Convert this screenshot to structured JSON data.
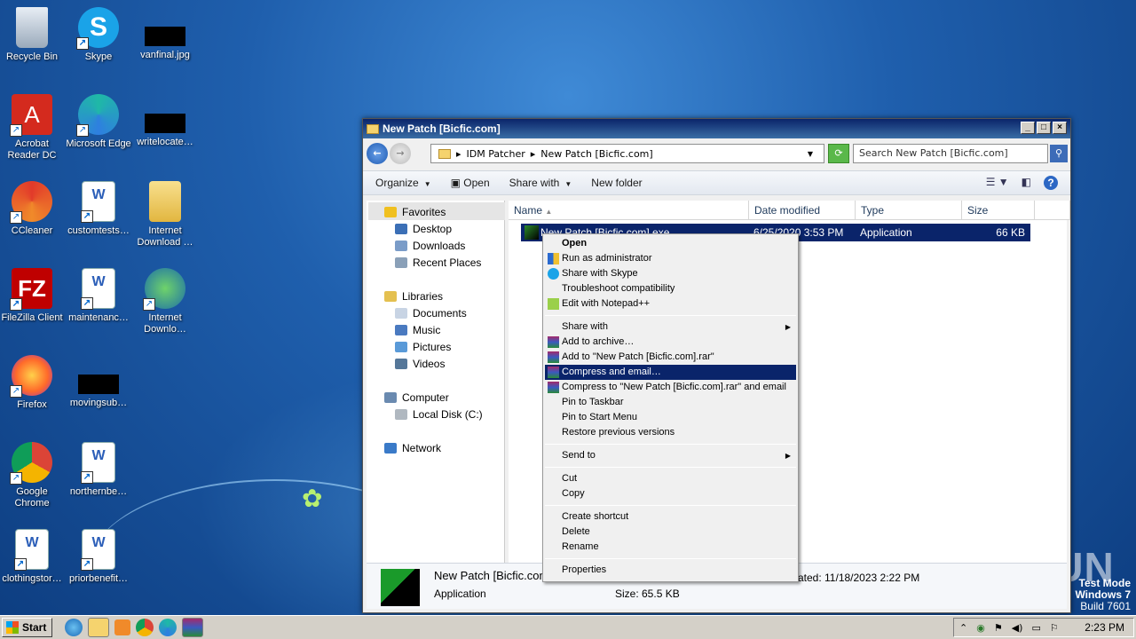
{
  "desktop": {
    "icons": [
      {
        "label": "Recycle Bin",
        "icon": "recycle-bin-icon"
      },
      {
        "label": "Skype",
        "icon": "skype-icon"
      },
      {
        "label": "vanfinal.jpg",
        "icon": "image-thumbnail-icon"
      },
      {
        "label": "Acrobat Reader DC",
        "icon": "acrobat-icon"
      },
      {
        "label": "Microsoft Edge",
        "icon": "edge-icon"
      },
      {
        "label": "writelocate…",
        "icon": "image-thumbnail-icon"
      },
      {
        "label": "CCleaner",
        "icon": "ccleaner-icon"
      },
      {
        "label": "customtests…",
        "icon": "word-doc-icon"
      },
      {
        "label": "Internet Download …",
        "icon": "folder-icon"
      },
      {
        "label": "FileZilla Client",
        "icon": "filezilla-icon"
      },
      {
        "label": "maintenanc…",
        "icon": "word-doc-icon"
      },
      {
        "label": "Internet Downlo…",
        "icon": "idm-icon"
      },
      {
        "label": "Firefox",
        "icon": "firefox-icon"
      },
      {
        "label": "movingsub…",
        "icon": "image-thumbnail-icon"
      },
      {
        "label": "Google Chrome",
        "icon": "chrome-icon"
      },
      {
        "label": "northernbe…",
        "icon": "word-doc-icon"
      },
      {
        "label": "clothingstor…",
        "icon": "word-doc-icon"
      },
      {
        "label": "priorbenefit…",
        "icon": "word-doc-icon"
      }
    ]
  },
  "window": {
    "title": "New Patch [Bicfic.com]",
    "breadcrumb": [
      "IDM Patcher",
      "New Patch [Bicfic.com]"
    ],
    "search_placeholder": "Search New Patch [Bicfic.com]",
    "toolbar": {
      "organize": "Organize",
      "open": "Open",
      "share_with": "Share with",
      "new_folder": "New folder"
    },
    "nav": {
      "favorites": "Favorites",
      "desktop": "Desktop",
      "downloads": "Downloads",
      "recent": "Recent Places",
      "libraries": "Libraries",
      "documents": "Documents",
      "music": "Music",
      "pictures": "Pictures",
      "videos": "Videos",
      "computer": "Computer",
      "local_disk": "Local Disk (C:)",
      "network": "Network"
    },
    "columns": {
      "name": "Name",
      "date": "Date modified",
      "type": "Type",
      "size": "Size"
    },
    "file": {
      "name": "New Patch [Bicfic.com].exe",
      "date": "6/25/2020 3:53 PM",
      "type": "Application",
      "size": "66 KB"
    },
    "details": {
      "name": "New Patch [Bicfic.com]",
      "type": "Application",
      "size": "Size: 65.5 KB",
      "date": "ated: 11/18/2023 2:22 PM"
    }
  },
  "context_menu": {
    "open": "Open",
    "run_admin": "Run as administrator",
    "share_skype": "Share with Skype",
    "troubleshoot": "Troubleshoot compatibility",
    "notepad": "Edit with Notepad++",
    "share_with": "Share with",
    "add_archive": "Add to archive…",
    "add_rar": "Add to \"New Patch [Bicfic.com].rar\"",
    "compress_email": "Compress and email…",
    "compress_rar_email": "Compress to \"New Patch [Bicfic.com].rar\" and email",
    "pin_taskbar": "Pin to Taskbar",
    "pin_start": "Pin to Start Menu",
    "restore": "Restore previous versions",
    "send_to": "Send to",
    "cut": "Cut",
    "copy": "Copy",
    "create_shortcut": "Create shortcut",
    "delete": "Delete",
    "rename": "Rename",
    "properties": "Properties"
  },
  "taskbar": {
    "start": "Start",
    "clock": "2:23 PM"
  },
  "watermark": {
    "line1": "Test Mode",
    "line2": "Windows 7",
    "line3": "Build 7601",
    "brand": "ANY RUN"
  }
}
